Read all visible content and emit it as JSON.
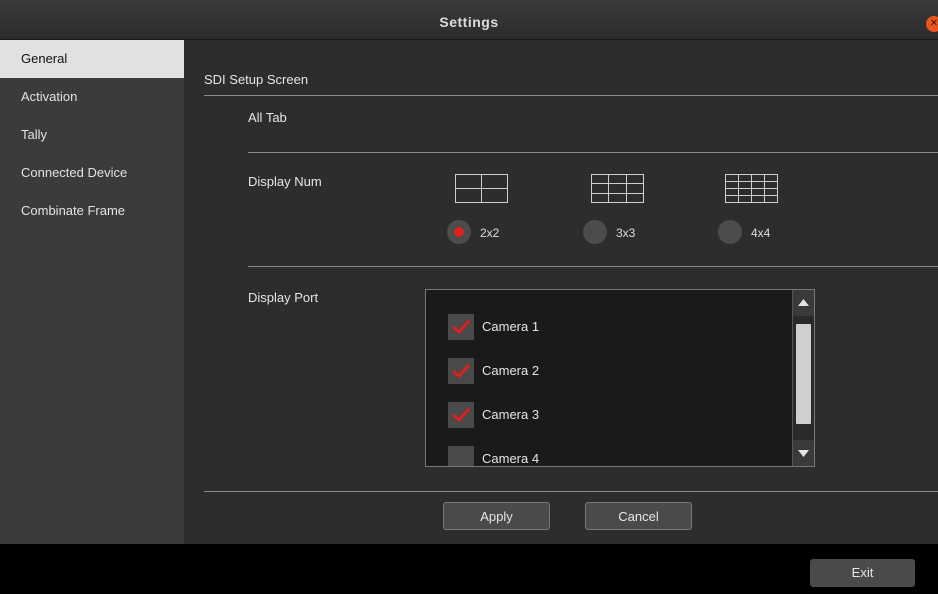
{
  "window": {
    "title": "Settings"
  },
  "sidebar": {
    "items": [
      {
        "label": "General",
        "active": true
      },
      {
        "label": "Activation",
        "active": false
      },
      {
        "label": "Tally",
        "active": false
      },
      {
        "label": "Connected Device",
        "active": false
      },
      {
        "label": "Combinate Frame",
        "active": false
      }
    ]
  },
  "main": {
    "section_title": "SDI Setup Screen",
    "tab_label": "All Tab",
    "display_num": {
      "label": "Display Num",
      "options": [
        {
          "label": "2x2",
          "checked": true
        },
        {
          "label": "3x3",
          "checked": false
        },
        {
          "label": "4x4",
          "checked": false
        }
      ]
    },
    "display_port": {
      "label": "Display Port",
      "cameras": [
        {
          "label": "Camera 1",
          "checked": true
        },
        {
          "label": "Camera 2",
          "checked": true
        },
        {
          "label": "Camera 3",
          "checked": true
        },
        {
          "label": "Camera 4",
          "checked": false
        }
      ]
    },
    "apply_label": "Apply",
    "cancel_label": "Cancel"
  },
  "footer": {
    "exit_label": "Exit"
  },
  "colors": {
    "accent": "#e0201b",
    "sidebar_active_bg": "#e1e1e1",
    "close_button": "#e9541f"
  },
  "icons": {
    "close": "close-icon",
    "grid_2x2": "grid-2x2-icon",
    "grid_3x3": "grid-3x3-icon",
    "grid_4x4": "grid-4x4-icon"
  }
}
